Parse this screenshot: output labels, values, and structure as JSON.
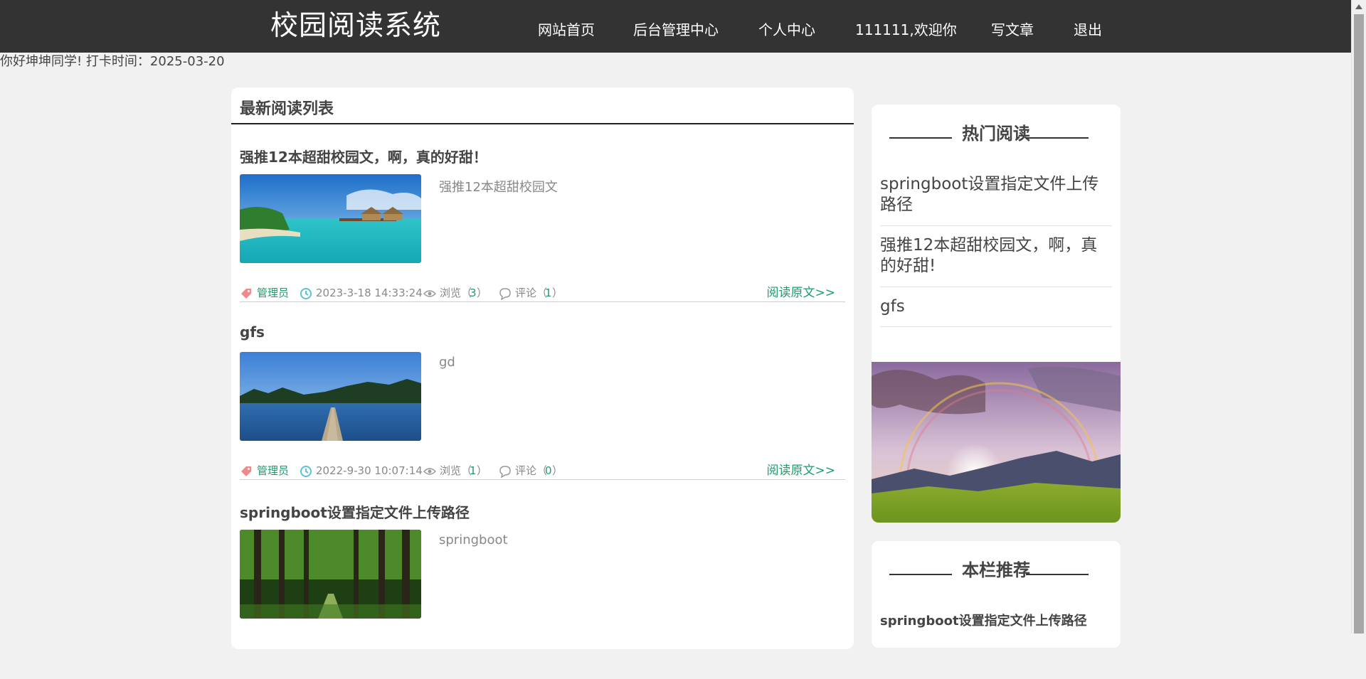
{
  "header": {
    "logo": "校园阅读系统",
    "nav": [
      {
        "label": "网站首页"
      },
      {
        "label": "后台管理中心"
      },
      {
        "label": "个人中心"
      },
      {
        "label": "111111,欢迎你"
      },
      {
        "label": "写文章"
      },
      {
        "label": "退出"
      }
    ]
  },
  "greeting": "你好坤坤同学! 打卡时间：2025-03-20",
  "main": {
    "title": "最新阅读列表",
    "articles": [
      {
        "title": "强推12本超甜校园文，啊，真的好甜！",
        "excerpt": "强推12本超甜校园文",
        "author": "管理员",
        "date": "2023-3-18 14:33:24",
        "views_label": "浏览（",
        "views": "3",
        "comments_label": "评论（",
        "comments": "1",
        "close": "）",
        "readmore": "阅读原文>>",
        "image": "tropical-island-photo"
      },
      {
        "title": "gfs",
        "excerpt": "gd",
        "author": "管理员",
        "date": "2022-9-30 10:07:14",
        "views_label": "浏览（",
        "views": "1",
        "comments_label": "评论（",
        "comments": "0",
        "close": "）",
        "readmore": "阅读原文>>",
        "image": "lake-pier-photo"
      },
      {
        "title": "springboot设置指定文件上传路径",
        "excerpt": "springboot",
        "image": "forest-path-photo"
      }
    ]
  },
  "sidebar": {
    "hot_title": "热门阅读",
    "hot_items": [
      {
        "label": "springboot设置指定文件上传路径"
      },
      {
        "label": "强推12本超甜校园文，啊，真的好甜!"
      },
      {
        "label": "gfs"
      }
    ],
    "hot_image": "rainbow-landscape-photo",
    "rec_title": "本栏推荐",
    "rec_items": [
      {
        "label": "springboot设置指定文件上传路径"
      }
    ]
  },
  "colors": {
    "header_bg": "#333333",
    "page_bg": "#f1f1f1",
    "accent_green": "#1f9a6b",
    "tag_pink": "#f08a8a",
    "clock_blue": "#5bc0de"
  }
}
